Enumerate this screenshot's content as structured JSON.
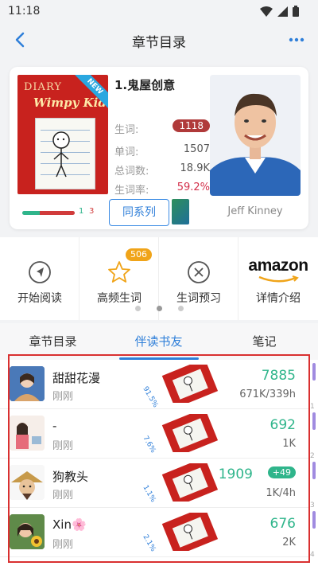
{
  "status": {
    "time": "11:18"
  },
  "nav": {
    "title": "章节目录"
  },
  "book": {
    "cover_title": "DIARY",
    "cover_sub": "Wimpy Kid",
    "cover_badge": "NEW",
    "name": "1.鬼屋创意",
    "new_words_label": "生词:",
    "new_words_value": "1118",
    "words_label": "单词:",
    "words_value": "1507",
    "total_label": "总词数:",
    "total_value": "18.9K",
    "rate_label": "生词率:",
    "rate_value": "59.2%",
    "progress_green_count": "1",
    "progress_red_count": "3",
    "series_button": "同系列",
    "author": "Jeff Kinney",
    "colors": {
      "green": "#2fb58b",
      "red": "#d13b3b",
      "accent": "#2f7fd9"
    }
  },
  "actions": [
    {
      "label": "开始阅读",
      "icon": "compass-icon"
    },
    {
      "label": "高频生词",
      "icon": "star-icon",
      "badge": "506"
    },
    {
      "label": "生词预习",
      "icon": "circle-x-icon"
    },
    {
      "label": "详情介绍",
      "icon": "amazon-logo",
      "logo_text": "amazon"
    }
  ],
  "tabs": [
    {
      "label": "章节目录"
    },
    {
      "label": "伴读书友",
      "active": true
    },
    {
      "label": "笔记"
    }
  ],
  "friends": [
    {
      "name": "甜甜花漫",
      "time": "刚刚",
      "pct": "91.5%",
      "score": "7885",
      "sub": "671K/339h"
    },
    {
      "name": "-",
      "time": "刚刚",
      "pct": "7.6%",
      "score": "692",
      "sub": "1K"
    },
    {
      "name": "狗教头",
      "time": "刚刚",
      "pct": "1.1%",
      "score": "1909",
      "plus": "+49",
      "sub": "1K/4h"
    },
    {
      "name": "Xin🌸",
      "time": "刚刚",
      "pct": "2.1%",
      "score": "676",
      "sub": "2K"
    }
  ],
  "side_numbers": [
    "1",
    "2",
    "3",
    "4"
  ]
}
